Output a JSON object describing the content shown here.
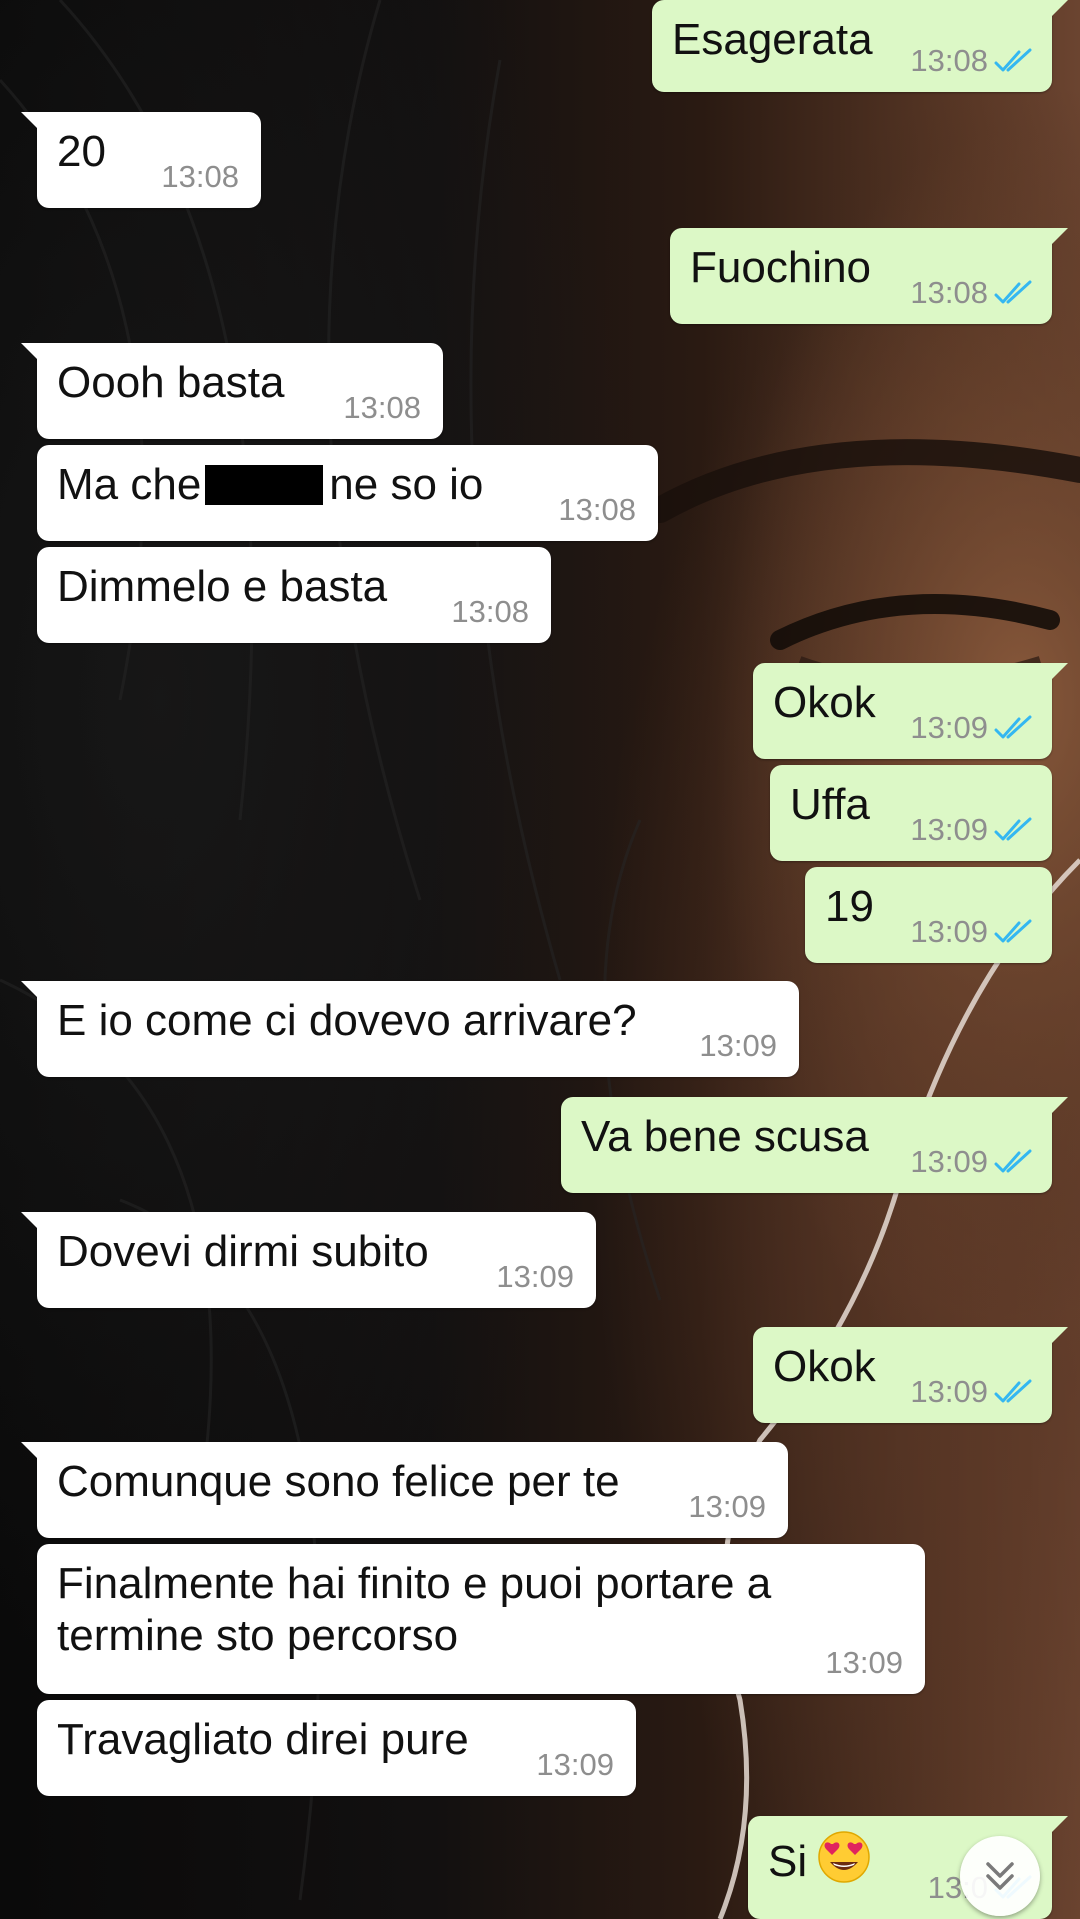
{
  "wallpaper": {
    "description_icon": "photo-wallpaper"
  },
  "colors": {
    "incoming_bubble": "#ffffff",
    "outgoing_bubble": "#dcf8c6",
    "read_ticks": "#34b7f1",
    "timestamp": "#8e8e8e"
  },
  "messages": [
    {
      "dir": "out",
      "text": "Esagerata",
      "time": "13:08",
      "status": "read"
    },
    {
      "dir": "in",
      "text": "20",
      "time": "13:08"
    },
    {
      "dir": "out",
      "text": "Fuochino",
      "time": "13:08",
      "status": "read"
    },
    {
      "dir": "in",
      "text": "Oooh basta",
      "time": "13:08"
    },
    {
      "dir": "in",
      "text_before": "Ma che",
      "text_after": "ne so io",
      "time": "13:08",
      "redacted": true
    },
    {
      "dir": "in",
      "text": "Dimmelo e basta",
      "time": "13:08"
    },
    {
      "dir": "out",
      "text": "Okok",
      "time": "13:09",
      "status": "read"
    },
    {
      "dir": "out",
      "text": "Uffa",
      "time": "13:09",
      "status": "read"
    },
    {
      "dir": "out",
      "text": "19",
      "time": "13:09",
      "status": "read"
    },
    {
      "dir": "in",
      "text": "E io come ci dovevo arrivare?",
      "time": "13:09"
    },
    {
      "dir": "out",
      "text": "Va bene scusa",
      "time": "13:09",
      "status": "read"
    },
    {
      "dir": "in",
      "text": "Dovevi dirmi subito",
      "time": "13:09"
    },
    {
      "dir": "out",
      "text": "Okok",
      "time": "13:09",
      "status": "read"
    },
    {
      "dir": "in",
      "text": "Comunque sono felice per te",
      "time": "13:09"
    },
    {
      "dir": "in",
      "text": "Finalmente hai finito e puoi portare a\ntermine sto percorso",
      "time": "13:09"
    },
    {
      "dir": "in",
      "text": "Travagliato direi pure",
      "time": "13:09"
    },
    {
      "dir": "out",
      "text": "Si",
      "emoji": "heart-eyes-emoji",
      "time": "13:0",
      "status": "read"
    }
  ],
  "scroll_button": {
    "icon": "double-chevron-down-icon"
  }
}
